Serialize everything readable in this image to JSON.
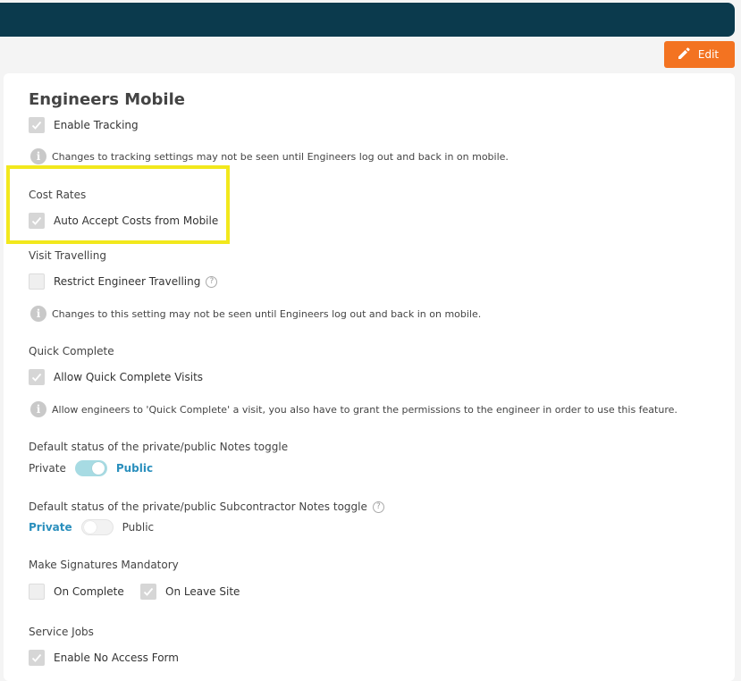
{
  "header": {
    "edit_label": "Edit"
  },
  "page": {
    "title": "Engineers Mobile",
    "enable_tracking": {
      "label": "Enable Tracking",
      "checked": true
    },
    "tracking_info": "Changes to tracking settings may not be seen until Engineers log out and back in on mobile.",
    "cost_rates": {
      "heading": "Cost Rates",
      "auto_accept": {
        "label": "Auto Accept Costs from Mobile",
        "checked": true
      }
    },
    "visit_travelling": {
      "heading": "Visit Travelling",
      "restrict": {
        "label": "Restrict Engineer Travelling",
        "checked": false
      },
      "info": "Changes to this setting may not be seen until Engineers log out and back in on mobile."
    },
    "quick_complete": {
      "heading": "Quick Complete",
      "allow": {
        "label": "Allow Quick Complete Visits",
        "checked": true
      },
      "info": "Allow engineers to 'Quick Complete' a visit, you also have to grant the permissions to the engineer in order to use this feature."
    },
    "notes_toggle": {
      "heading": "Default status of the private/public Notes toggle",
      "left_label": "Private",
      "right_label": "Public",
      "selected": "Public"
    },
    "sub_notes_toggle": {
      "heading": "Default status of the private/public Subcontractor Notes toggle",
      "left_label": "Private",
      "right_label": "Public",
      "selected": "Private"
    },
    "signatures": {
      "heading": "Make Signatures Mandatory",
      "on_complete": {
        "label": "On Complete",
        "checked": false
      },
      "on_leave_site": {
        "label": "On Leave Site",
        "checked": true
      }
    },
    "service_jobs": {
      "heading": "Service Jobs",
      "no_access": {
        "label": "Enable No Access Form",
        "checked": true
      }
    }
  },
  "colors": {
    "topbar": "#0b3a4d",
    "edit_button": "#f37321",
    "toggle_active_text": "#2a8fbd",
    "highlight": "#f2e81c"
  }
}
